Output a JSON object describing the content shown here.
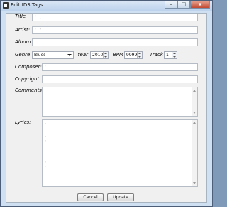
{
  "window": {
    "title": "Edit ID3 Tags",
    "minimize_glyph": "–",
    "maximize_glyph": "□",
    "close_glyph": "x"
  },
  "labels": {
    "title": "Title",
    "artist": "Artist:",
    "album": "Album",
    "genre": "Genre",
    "year": "Year",
    "bpm": "BPM",
    "track": "Track",
    "composer": "Composer:",
    "copyright": "Copyright:",
    "comments": "Comments",
    "lyrics": "Lyrics:"
  },
  "fields": {
    "title": "' ' ,",
    "artist": "' ' '",
    "album": "",
    "genre": "Blues",
    "year": "2010",
    "bpm": "9999",
    "track": "1",
    "composer": "' ,",
    "copyright": "",
    "comments": "",
    "lyrics": "\\\n.\n.\n\\\n\\\n.\n.\n.\n.\n\\\n\\"
  },
  "buttons": {
    "cancel": "Cancel",
    "update": "Update"
  },
  "icons": {
    "app": "document-icon"
  }
}
